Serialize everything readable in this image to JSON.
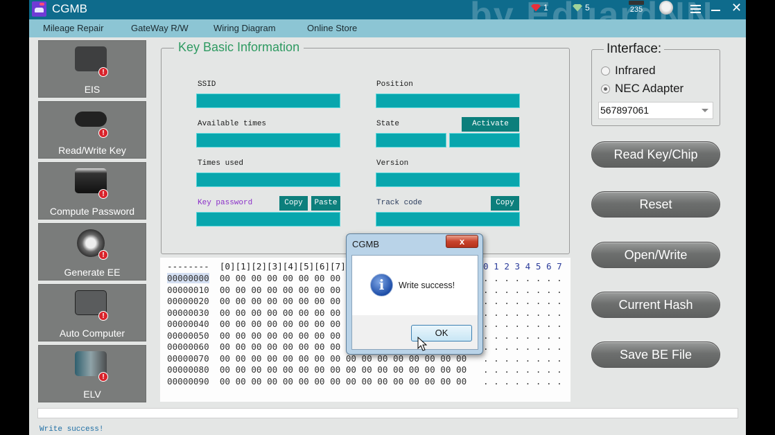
{
  "window": {
    "title": "CGMB",
    "watermark": "by EduardNN",
    "badges": {
      "red_gems": "1",
      "green_gems": "5",
      "counter": "235"
    }
  },
  "menu": [
    "Mileage Repair",
    "GateWay R/W",
    "Wiring Diagram",
    "Online Store"
  ],
  "sidebar": [
    {
      "label": "EIS",
      "icon": "ignition-switch-icon"
    },
    {
      "label": "Read/Write Key",
      "icon": "car-key-icon"
    },
    {
      "label": "Compute Password",
      "icon": "monitor-icon"
    },
    {
      "label": "Generate EE",
      "icon": "printer-icon"
    },
    {
      "label": "Auto Computer",
      "icon": "ecu-icon"
    },
    {
      "label": "ELV",
      "icon": "circuit-board-icon"
    }
  ],
  "key_info": {
    "title": "Key Basic Information",
    "labels": {
      "ssid": "SSID",
      "position": "Position",
      "available_times": "Available times",
      "state": "State",
      "times_used": "Times used",
      "version": "Version",
      "key_password": "Key password",
      "track_code": "Track code"
    },
    "buttons": {
      "activate": "Activate",
      "copy_password": "Copy",
      "paste_password": "Paste",
      "copy_track": "Copy"
    },
    "values": {
      "ssid": "",
      "position": "",
      "available_times": "",
      "state_1": "",
      "state_2": "",
      "times_used": "",
      "version": "",
      "key_password": "",
      "track_code": ""
    }
  },
  "hex": {
    "header": "--------  [0][1][2][3][4][5][6][7]",
    "ascii_header": "0 1 2 3 4 5 6 7",
    "rows": [
      {
        "offset": "00000000",
        "bytes": "00 00 00 00 00 00 00 00 00 00 00 00 00 00 00 00",
        "ascii": ". . . . . . . ."
      },
      {
        "offset": "00000010",
        "bytes": "00 00 00 00 00 00 00 00 00 00 00 00 00 00 00 00",
        "ascii": ". . . . . . . ."
      },
      {
        "offset": "00000020",
        "bytes": "00 00 00 00 00 00 00 00 00 00 00 00 00 00 00 00",
        "ascii": ". . . . . . . ."
      },
      {
        "offset": "00000030",
        "bytes": "00 00 00 00 00 00 00 00 00 00 00 00 00 00 00 00",
        "ascii": ". . . . . . . ."
      },
      {
        "offset": "00000040",
        "bytes": "00 00 00 00 00 00 00 00 00 00 00 00 00 00 00 00",
        "ascii": ". . . . . . . ."
      },
      {
        "offset": "00000050",
        "bytes": "00 00 00 00 00 00 00 00 00 00 00 00 00 00 00 00",
        "ascii": ". . . . . . . ."
      },
      {
        "offset": "00000060",
        "bytes": "00 00 00 00 00 00 00 00 00 00 00 00 00 00 00 00",
        "ascii": ". . . . . . . ."
      },
      {
        "offset": "00000070",
        "bytes": "00 00 00 00 00 00 00 00 00 00 00 00 00 00 00 00",
        "ascii": ". . . . . . . ."
      },
      {
        "offset": "00000080",
        "bytes": "00 00 00 00 00 00 00 00 00 00 00 00 00 00 00 00",
        "ascii": ". . . . . . . ."
      },
      {
        "offset": "00000090",
        "bytes": "00 00 00 00 00 00 00 00 00 00 00 00 00 00 00 00",
        "ascii": ". . . . . . . ."
      }
    ]
  },
  "interface": {
    "title": "Interface:",
    "options": [
      "Infrared",
      "NEC Adapter"
    ],
    "selected": "NEC Adapter",
    "device": "567897061"
  },
  "actions": [
    "Read Key/Chip",
    "Reset",
    "Open/Write",
    "Current Hash",
    "Save BE File"
  ],
  "progress": 0,
  "status": "Write success!",
  "dialog": {
    "title": "CGMB",
    "close": "x",
    "icon": "info",
    "message": "Write success!",
    "ok": "OK"
  }
}
